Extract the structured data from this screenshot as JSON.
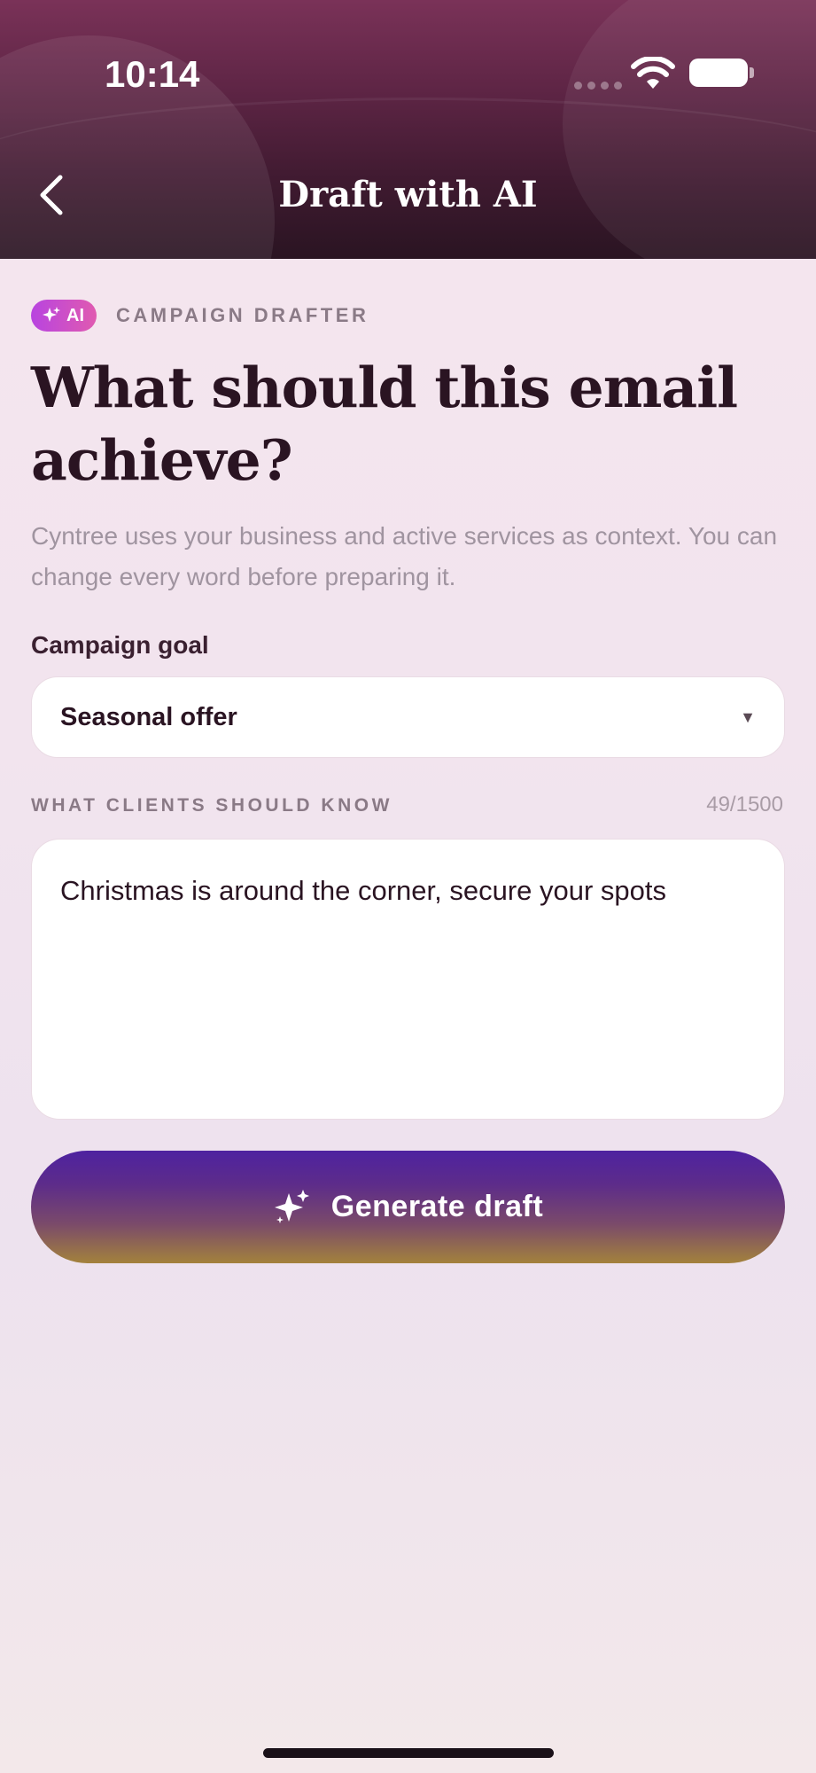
{
  "status_bar": {
    "time": "10:14"
  },
  "header": {
    "title": "Draft with AI"
  },
  "eyebrow": {
    "badge": "AI",
    "label": "CAMPAIGN DRAFTER"
  },
  "headline": "What should this email achieve?",
  "subtitle": "Cyntree uses your business and active services as context. You can change every word before preparing it.",
  "goal": {
    "label": "Campaign goal",
    "selected": "Seasonal offer"
  },
  "details": {
    "label": "WHAT CLIENTS SHOULD KNOW",
    "counter": "49/1500",
    "value": "Christmas is around the corner, secure your spots"
  },
  "generate_button": {
    "label": "Generate draft"
  }
}
